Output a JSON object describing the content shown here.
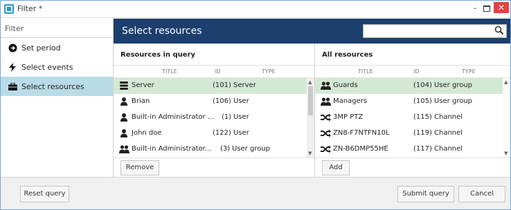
{
  "window": {
    "title": "Filter *",
    "minimize_label": "–",
    "close_label": "✕"
  },
  "sidebar": {
    "header": "Filter",
    "items": [
      {
        "label": "Set period",
        "icon": "clock-arrow-icon",
        "active": false
      },
      {
        "label": "Select events",
        "icon": "lightning-icon",
        "active": false
      },
      {
        "label": "Select resources",
        "icon": "briefcase-icon",
        "active": true
      }
    ]
  },
  "main": {
    "heading": "Select resources",
    "search": {
      "value": "",
      "placeholder": "",
      "icon": "search-icon"
    }
  },
  "query_panel": {
    "title": "Resources in query",
    "columns": [
      "TITLE",
      "ID",
      "TYPE"
    ],
    "rows": [
      {
        "icon": "server-icon",
        "title": "Server",
        "id": "(101)",
        "type": "Server",
        "selected": true
      },
      {
        "icon": "user-icon",
        "title": "Brian",
        "id": "(106)",
        "type": "User",
        "selected": false
      },
      {
        "icon": "user-icon",
        "title": "Built-in Administrator ...",
        "id": "(1)",
        "type": "User",
        "selected": false
      },
      {
        "icon": "user-icon",
        "title": "John doe",
        "id": "(122)",
        "type": "User",
        "selected": false
      },
      {
        "icon": "user-group-icon",
        "title": "Built-in Administrator...",
        "id": "(3)",
        "type": "User group",
        "selected": false
      }
    ],
    "button": "Remove"
  },
  "all_panel": {
    "title": "All resources",
    "columns": [
      "TITLE",
      "ID",
      "TYPE"
    ],
    "rows": [
      {
        "icon": "user-group-icon",
        "title": "Guards",
        "id": "(104)",
        "type": "User group",
        "selected": true
      },
      {
        "icon": "user-group-icon",
        "title": "Managers",
        "id": "(105)",
        "type": "User group",
        "selected": false
      },
      {
        "icon": "channel-icon",
        "title": "3MP PTZ",
        "id": "(115)",
        "type": "Channel",
        "selected": false
      },
      {
        "icon": "channel-icon",
        "title": "ZN8-F7NTFN10L",
        "id": "(119)",
        "type": "Channel",
        "selected": false
      },
      {
        "icon": "channel-icon",
        "title": "ZN-B6DMP55HE",
        "id": "(117)",
        "type": "Channel",
        "selected": false
      }
    ],
    "button": "Add"
  },
  "footer": {
    "reset_label": "Reset query",
    "submit_label": "Submit query",
    "cancel_label": "Cancel"
  },
  "colors": {
    "header_bg": "#1c3f6e",
    "sidebar_active": "#b9dbe8",
    "row_selected": "#d4e9d4",
    "close_button": "#e04343"
  }
}
